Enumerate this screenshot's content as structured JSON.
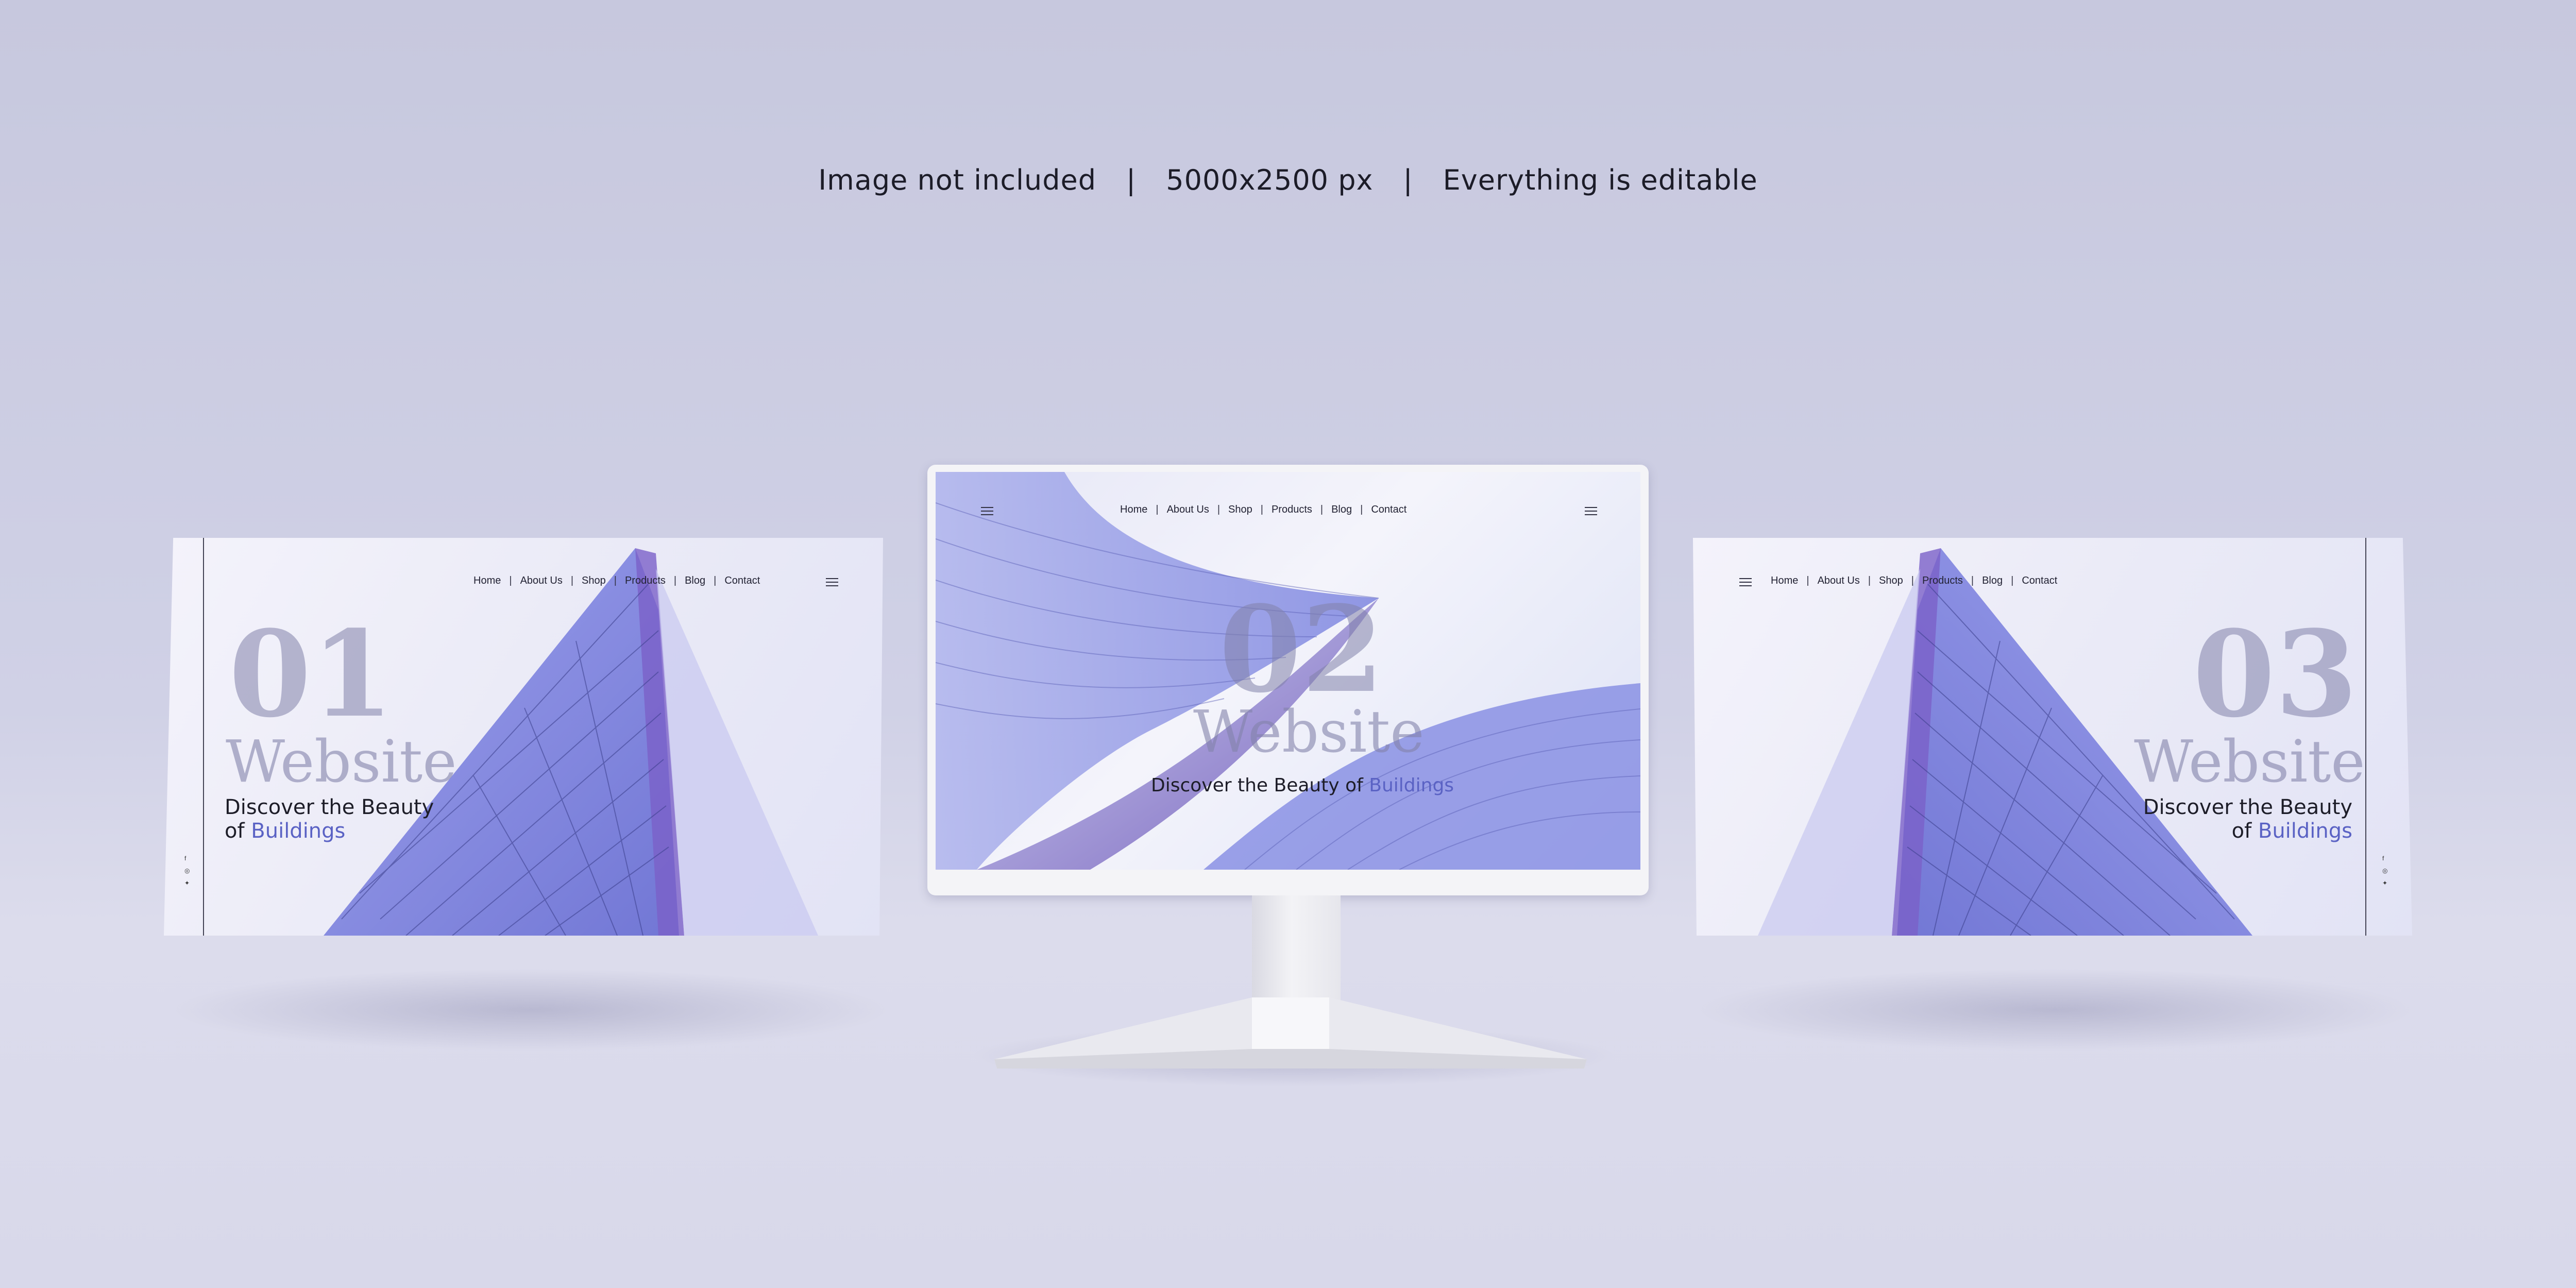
{
  "headline": {
    "left": "Image not included",
    "sep": "|",
    "middle": "5000x2500 px",
    "right": "Everything is editable"
  },
  "screens": {
    "left": {
      "nav": [
        "Home",
        "About Us",
        "Shop",
        "Products",
        "Blog",
        "Contact"
      ],
      "number": "01",
      "word": "Website",
      "tagline_1": "Discover the Beauty",
      "tagline_2": "of",
      "tagline_accent": "Buildings"
    },
    "center": {
      "nav": [
        "Home",
        "About Us",
        "Shop",
        "Products",
        "Blog",
        "Contact"
      ],
      "number": "02",
      "word": "Website",
      "tagline_1": "Discover the Beauty of",
      "tagline_accent": "Buildings"
    },
    "right": {
      "nav": [
        "Home",
        "About Us",
        "Shop",
        "Products",
        "Blog",
        "Contact"
      ],
      "number": "03",
      "word": "Website",
      "tagline_1": "Discover the Beauty",
      "tagline_2": "of",
      "tagline_accent": "Buildings"
    }
  },
  "nav_divider": "|",
  "colors": {
    "accent": "#5a62c4",
    "building": "#6c72d6"
  },
  "icons": [
    "menu-icon",
    "facebook-icon",
    "instagram-icon",
    "twitter-icon"
  ]
}
